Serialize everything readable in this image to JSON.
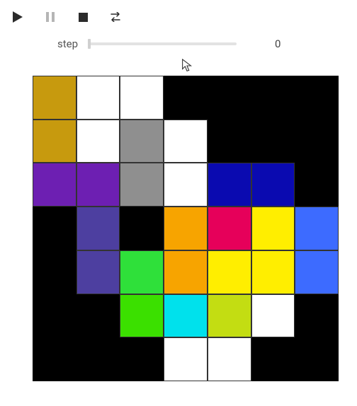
{
  "toolbar": {
    "play": {
      "icon": "play-icon",
      "enabled": true
    },
    "pause": {
      "icon": "pause-icon",
      "enabled": false
    },
    "stop": {
      "icon": "stop-icon",
      "enabled": true
    },
    "loop": {
      "icon": "loop-icon",
      "enabled": true
    }
  },
  "slider": {
    "label": "step",
    "value": "0",
    "min": 0,
    "max": 100,
    "position_pct": 0
  },
  "grid": {
    "rows": 7,
    "cols": 7,
    "palette": {
      "black": "#000000",
      "white": "#ffffff",
      "ochre": "#c79a0e",
      "gray": "#8f8f8f",
      "purple": "#6d1fb2",
      "navy": "#0a0ab0",
      "indigo": "#4d3fa0",
      "orange": "#f7a400",
      "crimson": "#e6005a",
      "yellow": "#ffee00",
      "blue": "#3d6bff",
      "green": "#2fe03a",
      "lime": "#3be000",
      "cyan": "#00e1ec",
      "olive": "#c3dd12"
    },
    "cells": [
      [
        "ochre",
        "white",
        "white",
        "black",
        "black",
        "black",
        "black"
      ],
      [
        "ochre",
        "white",
        "gray",
        "white",
        "black",
        "black",
        "black"
      ],
      [
        "purple",
        "purple",
        "gray",
        "white",
        "navy",
        "navy",
        "black"
      ],
      [
        "black",
        "indigo",
        "black",
        "orange",
        "crimson",
        "yellow",
        "blue"
      ],
      [
        "black",
        "indigo",
        "green",
        "orange",
        "yellow",
        "yellow",
        "blue"
      ],
      [
        "black",
        "black",
        "lime",
        "cyan",
        "olive",
        "white",
        "black"
      ],
      [
        "black",
        "black",
        "black",
        "white",
        "white",
        "black",
        "black"
      ]
    ]
  }
}
